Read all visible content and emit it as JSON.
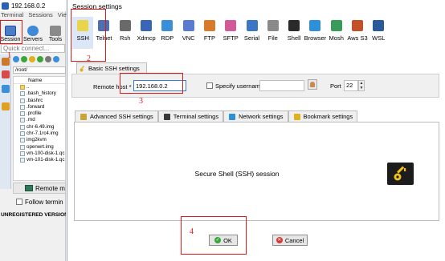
{
  "background_app": {
    "window_title": "192.168.0.2",
    "menu": [
      "Terminal",
      "Sessions",
      "View"
    ],
    "toolbar": {
      "session_label": "Session",
      "servers_label": "Servers",
      "tools_label": "Tools"
    },
    "quick_connect_placeholder": "Quick connect...",
    "path": "/root/",
    "file_column_header": "Name",
    "files": [
      {
        "name": "..",
        "type": "dir"
      },
      {
        "name": ".bash_history",
        "type": "file"
      },
      {
        "name": ".bashrc",
        "type": "file"
      },
      {
        "name": ".forward",
        "type": "file"
      },
      {
        "name": ".profile",
        "type": "file"
      },
      {
        "name": ".rnd",
        "type": "file"
      },
      {
        "name": "chr-6.49.img",
        "type": "file"
      },
      {
        "name": "chr-7.1rc4.img",
        "type": "file"
      },
      {
        "name": "img2kvm",
        "type": "file"
      },
      {
        "name": "openwrt.img",
        "type": "file"
      },
      {
        "name": "vm-100-disk-1.qc",
        "type": "file"
      },
      {
        "name": "vm-101-disk-1.qc",
        "type": "file"
      }
    ],
    "remote_monitoring_label": "Remote m",
    "follow_terminal_label": "Follow termin",
    "unregistered_label": "UNREGISTERED VERSION  -"
  },
  "dialog": {
    "title": "Session settings",
    "protocols": [
      {
        "label": "SSH",
        "icon": "ssh-icon",
        "color": "#e9d44a",
        "selected": true
      },
      {
        "label": "Telnet",
        "icon": "telnet-icon",
        "color": "#4f6fb3",
        "selected": false
      },
      {
        "label": "Rsh",
        "icon": "rsh-icon",
        "color": "#6a6a6a",
        "selected": false
      },
      {
        "label": "Xdmcp",
        "icon": "xdmcp-icon",
        "color": "#3a66b8",
        "selected": false
      },
      {
        "label": "RDP",
        "icon": "rdp-icon",
        "color": "#3a8fd8",
        "selected": false
      },
      {
        "label": "VNC",
        "icon": "vnc-icon",
        "color": "#5a7bd0",
        "selected": false
      },
      {
        "label": "FTP",
        "icon": "ftp-icon",
        "color": "#d87a2a",
        "selected": false
      },
      {
        "label": "SFTP",
        "icon": "sftp-icon",
        "color": "#d35a9a",
        "selected": false
      },
      {
        "label": "Serial",
        "icon": "serial-icon",
        "color": "#3a78c4",
        "selected": false
      },
      {
        "label": "File",
        "icon": "file-icon",
        "color": "#8a8a8a",
        "selected": false
      },
      {
        "label": "Shell",
        "icon": "shell-icon",
        "color": "#2a2a2a",
        "selected": false
      },
      {
        "label": "Browser",
        "icon": "browser-icon",
        "color": "#2d8fd8",
        "selected": false
      },
      {
        "label": "Mosh",
        "icon": "mosh-icon",
        "color": "#3a9a5a",
        "selected": false
      },
      {
        "label": "Aws S3",
        "icon": "aws-s3-icon",
        "color": "#c4502a",
        "selected": false
      },
      {
        "label": "WSL",
        "icon": "wsl-icon",
        "color": "#2a5a9a",
        "selected": false
      }
    ],
    "basic_tab_label": "Basic SSH settings",
    "remote_host_label": "Remote host *",
    "remote_host_value": "192.168.0.2",
    "specify_username_label": "Specify username",
    "specify_username_checked": false,
    "username_value": "",
    "port_label": "Port",
    "port_value": "22",
    "advanced_tabs": [
      {
        "label": "Advanced SSH settings",
        "icon": "wrench-icon",
        "color": "#c9a43a"
      },
      {
        "label": "Terminal settings",
        "icon": "terminal-icon",
        "color": "#3a3a3a"
      },
      {
        "label": "Network settings",
        "icon": "network-icon",
        "color": "#2d8fd8"
      },
      {
        "label": "Bookmark settings",
        "icon": "star-icon",
        "color": "#e0b020"
      }
    ],
    "session_description": "Secure Shell (SSH) session",
    "ok_label": "OK",
    "cancel_label": "Cancel"
  },
  "annotations": [
    "1",
    "2",
    "3",
    "4"
  ],
  "accent_color": "#e01818"
}
